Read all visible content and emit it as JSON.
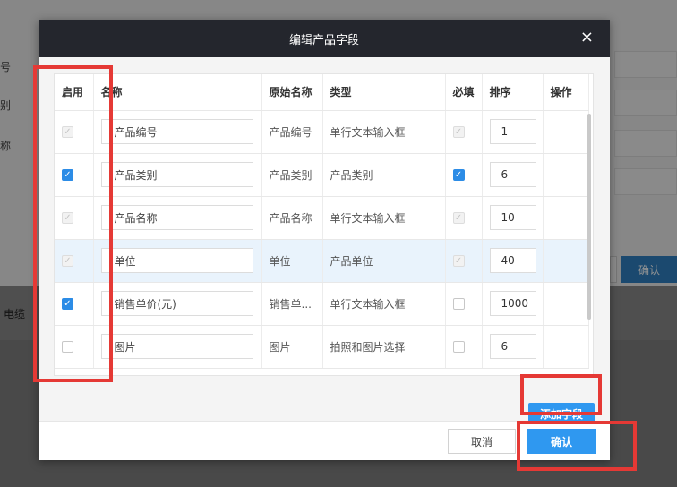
{
  "background": {
    "labels": [
      "号",
      "别",
      "称"
    ],
    "confirm_label": "确认",
    "strip_text": "电缆"
  },
  "dialog": {
    "title": "编辑产品字段",
    "close_glyph": "×",
    "columns": {
      "enabled": "启用",
      "name": "名称",
      "original_name": "原始名称",
      "type": "类型",
      "required": "必填",
      "sort": "排序",
      "actions": "操作"
    },
    "rows": [
      {
        "enabled": "disabled-checked",
        "name": "产品编号",
        "original_name": "产品编号",
        "type": "单行文本输入框",
        "required": "disabled-checked",
        "sort": "1"
      },
      {
        "enabled": "checked",
        "name": "产品类别",
        "original_name": "产品类别",
        "type": "产品类别",
        "required": "checked",
        "sort": "6"
      },
      {
        "enabled": "disabled-checked",
        "name": "产品名称",
        "original_name": "产品名称",
        "type": "单行文本输入框",
        "required": "disabled-checked",
        "sort": "10"
      },
      {
        "enabled": "disabled-checked",
        "name": "单位",
        "original_name": "单位",
        "type": "产品单位",
        "required": "disabled-checked",
        "sort": "40",
        "selected": true
      },
      {
        "enabled": "checked",
        "name": "销售单价(元)",
        "original_name": "销售单...",
        "type": "单行文本输入框",
        "required": "unchecked",
        "sort": "1000"
      },
      {
        "enabled": "unchecked",
        "name": "图片",
        "original_name": "图片",
        "type": "拍照和图片选择",
        "required": "unchecked",
        "sort": "6"
      }
    ],
    "add_field_label": "添加字段",
    "cancel_label": "取消",
    "confirm_label": "确认"
  },
  "colors": {
    "accent": "#2f98f0",
    "header_bg": "#24262d",
    "highlight": "#e53935"
  }
}
